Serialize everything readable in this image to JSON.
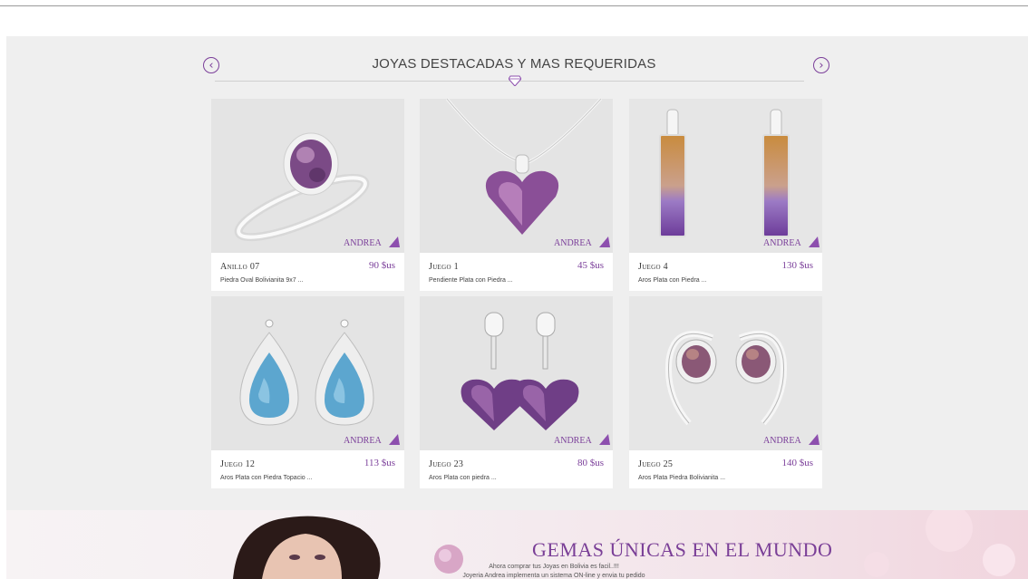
{
  "section": {
    "title": "JOYAS DESTACADAS Y MAS REQUERIDAS",
    "prev_icon": "chevron-left-circle-icon",
    "next_icon": "chevron-right-circle-icon",
    "prev_glyph": "‹",
    "next_glyph": "›"
  },
  "brand_color": "#7b3f9a",
  "products": [
    {
      "name": "Anillo 07",
      "price": "90 $us",
      "desc": "Piedra Oval Bolivianita 9x7 ...",
      "image": "ring-icon"
    },
    {
      "name": "Juego 1",
      "price": "45 $us",
      "desc": "Pendiente Plata con Piedra ...",
      "image": "heart-pendant-icon"
    },
    {
      "name": "Juego 4",
      "price": "130 $us",
      "desc": "Aros Plata con Piedra ...",
      "image": "bar-earrings-icon"
    },
    {
      "name": "Juego 12",
      "price": "113 $us",
      "desc": "Aros Plata con Piedra Topacio ...",
      "image": "teardrop-earrings-icon"
    },
    {
      "name": "Juego 23",
      "price": "80 $us",
      "desc": "Aros Plata con piedra ...",
      "image": "heart-earrings-icon"
    },
    {
      "name": "Juego 25",
      "price": "140 $us",
      "desc": "Aros Plata Piedra Bolivianita ...",
      "image": "hoop-earrings-icon"
    }
  ],
  "banner": {
    "title": "GEMAS ÚNICAS EN EL MUNDO",
    "line1": "Ahora comprar tus Joyas en Bolivia es facil..!!!",
    "line2": "Joyeria Andrea implementa un sistema ON-line y envia tu pedido"
  }
}
